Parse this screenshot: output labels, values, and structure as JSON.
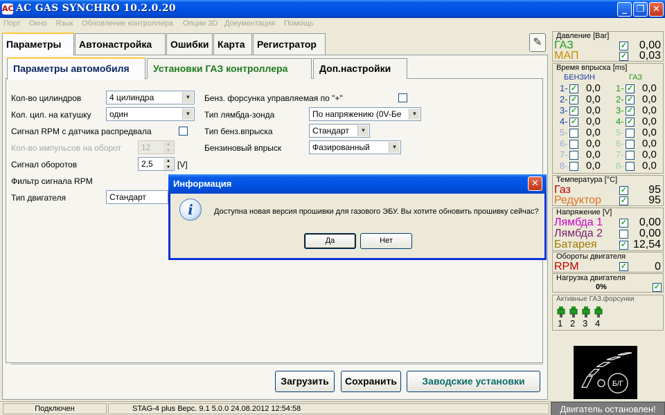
{
  "window": {
    "title": "AC GAS SYNCHRO  10.2.0.20",
    "app_icon": "ac-logo-icon",
    "minimize": "_",
    "maximize": "❐",
    "close": "✕"
  },
  "menu": [
    "Порт",
    "Окно",
    "Язык",
    "Обновление контроллера",
    "Опции 3D",
    "Документация",
    "Помощь"
  ],
  "tabs": [
    "Параметры",
    "Автонастройка",
    "Ошибки",
    "Карта",
    "Регистратор"
  ],
  "help_icon": "pen-help-icon",
  "subtabs": [
    "Параметры автомобиля",
    "Установки ГАЗ контроллера",
    "Доп.настройки"
  ],
  "form_left": {
    "cylinders_label": "Кол-во цилиндров",
    "cylinders_value": "4 цилиндра",
    "coil_label": "Кол. цил. на катушку",
    "coil_value": "один",
    "rpm_cam_label": "Сигнал RPM с датчика распредвала",
    "pulses_label": "Кол-во импульсов на оборот",
    "pulses_value": "12",
    "rpm_signal_label": "Сигнал оборотов",
    "rpm_signal_value": "2,5",
    "rpm_signal_unit": "[V]",
    "rpm_filter_label": "Фильтр сигнала RPM",
    "engine_type_label": "Тип двигателя",
    "engine_type_value": "Стандарт"
  },
  "form_right": {
    "petrol_injector_label": "Бенз. форсунка управляемая по \"+\"",
    "lambda_type_label": "Тип лямбда-зонда",
    "lambda_type_value": "По напряжению  (0V-Бе",
    "petrol_injection_type_label": "Тип бенз.впрыска",
    "petrol_injection_type_value": "Стандарт",
    "petrol_injection_label": "Бензиновый впрыск",
    "petrol_injection_value": "Фазированный"
  },
  "buttons": {
    "load": "Загрузить",
    "save": "Сохранить",
    "factory": "Заводские установки"
  },
  "dialog": {
    "title": "Информация",
    "message": "Доступна новая версия прошивки для газового ЭБУ. Вы хотите обновить прошивку сейчас?",
    "yes": "Да",
    "no": "Нет",
    "icon": "info-icon"
  },
  "status": {
    "connection": "Подключен",
    "device": "STAG-4 plus   Верс. 9.1  5.0.0    24.08.2012 12:54:58",
    "engine": "Двигатель остановлен!"
  },
  "pressure": {
    "title": "Давление [Bar]",
    "gas_label": "ГАЗ",
    "gas_value": "0,00",
    "map_label": "МАП",
    "map_value": "0,03"
  },
  "injection": {
    "title": "Время впрыска [ms]",
    "petrol_header": "БЕНЗИН",
    "gas_header": "ГАЗ",
    "rows": [
      {
        "petrol_label": "1-",
        "petrol_checked": true,
        "petrol_value": "0,0",
        "gas_label": "1-",
        "gas_checked": true,
        "gas_value": "0,0"
      },
      {
        "petrol_label": "2-",
        "petrol_checked": true,
        "petrol_value": "0,0",
        "gas_label": "2-",
        "gas_checked": true,
        "gas_value": "0,0"
      },
      {
        "petrol_label": "3-",
        "petrol_checked": true,
        "petrol_value": "0,0",
        "gas_label": "3-",
        "gas_checked": true,
        "gas_value": "0,0"
      },
      {
        "petrol_label": "4-",
        "petrol_checked": true,
        "petrol_value": "0,0",
        "gas_label": "4-",
        "gas_checked": true,
        "gas_value": "0,0"
      },
      {
        "petrol_label": "5-",
        "petrol_checked": false,
        "petrol_value": "0,0",
        "gas_label": "5-",
        "gas_checked": false,
        "gas_value": "0,0"
      },
      {
        "petrol_label": "6-",
        "petrol_checked": false,
        "petrol_value": "0,0",
        "gas_label": "6-",
        "gas_checked": false,
        "gas_value": "0,0"
      },
      {
        "petrol_label": "7-",
        "petrol_checked": false,
        "petrol_value": "0,0",
        "gas_label": "7-",
        "gas_checked": false,
        "gas_value": "0,0"
      },
      {
        "petrol_label": "8-",
        "petrol_checked": false,
        "petrol_value": "0,0",
        "gas_label": "8-",
        "gas_checked": false,
        "gas_value": "0,0"
      }
    ]
  },
  "temperature": {
    "title": "Температура  [°C]",
    "gas_label": "Газ",
    "gas_value": "95",
    "reducer_label": "Редуктор",
    "reducer_value": "95"
  },
  "voltage": {
    "title": "Напряжение [V]",
    "lambda1_label": "Лямбда 1",
    "lambda1_value": "0,00",
    "lambda2_label": "Лямбда 2",
    "lambda2_value": "0,00",
    "battery_label": "Батарея",
    "battery_value": "12,54"
  },
  "rpm": {
    "title": "Обороты двигателя",
    "label": "RPM",
    "value": "0"
  },
  "load": {
    "title": "Нагрузка двигателя",
    "value": "0%"
  },
  "active_injectors": {
    "title": "Активные ГАЗ.форсунки",
    "numbers": [
      "1",
      "2",
      "3",
      "4"
    ]
  },
  "engine_icon": {
    "label": "Б/Г"
  },
  "colors": {
    "gas_green": "#1f9a1f",
    "map_orange": "#c98a00",
    "temp_red": "#c00000",
    "reducer_orange": "#e07020",
    "lambda1": "#cc00cc",
    "lambda2": "#7a1f6a",
    "battery": "#a07a00",
    "petrol_blue": "#1d3fa8"
  }
}
